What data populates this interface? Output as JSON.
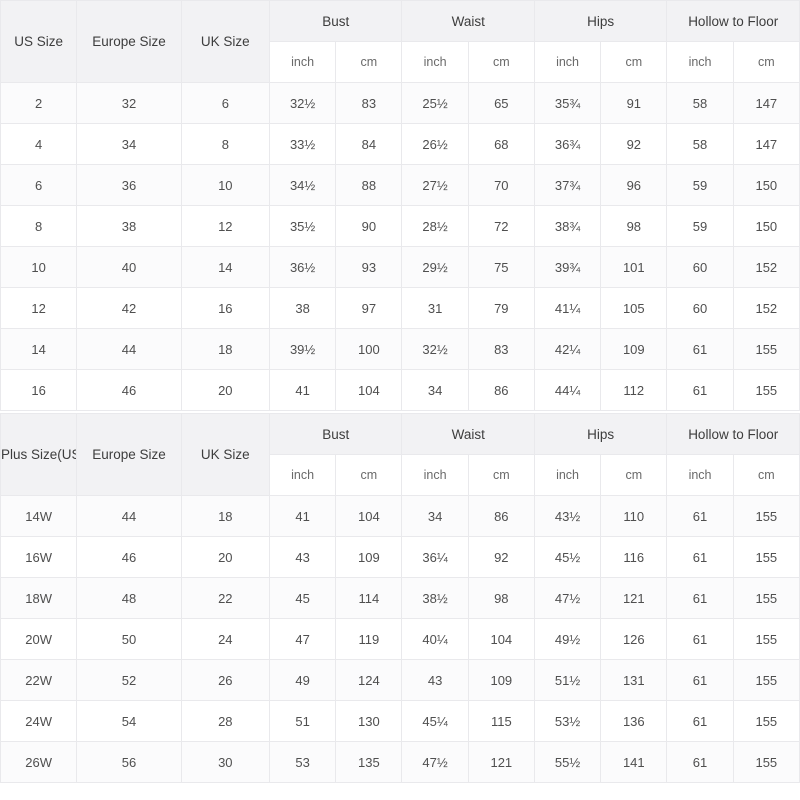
{
  "tables": [
    {
      "id": "standard-size-table",
      "headers": {
        "size": "US Size",
        "europe": "Europe Size",
        "uk": "UK Size",
        "bust": "Bust",
        "waist": "Waist",
        "hips": "Hips",
        "hollow": "Hollow to Floor"
      },
      "units": {
        "inch": "inch",
        "cm": "cm"
      },
      "rows": [
        {
          "size": "2",
          "europe": "32",
          "uk": "6",
          "bust_in": "32½",
          "bust_cm": "83",
          "waist_in": "25½",
          "waist_cm": "65",
          "hips_in": "35¾",
          "hips_cm": "91",
          "hollow_in": "58",
          "hollow_cm": "147"
        },
        {
          "size": "4",
          "europe": "34",
          "uk": "8",
          "bust_in": "33½",
          "bust_cm": "84",
          "waist_in": "26½",
          "waist_cm": "68",
          "hips_in": "36¾",
          "hips_cm": "92",
          "hollow_in": "58",
          "hollow_cm": "147"
        },
        {
          "size": "6",
          "europe": "36",
          "uk": "10",
          "bust_in": "34½",
          "bust_cm": "88",
          "waist_in": "27½",
          "waist_cm": "70",
          "hips_in": "37¾",
          "hips_cm": "96",
          "hollow_in": "59",
          "hollow_cm": "150"
        },
        {
          "size": "8",
          "europe": "38",
          "uk": "12",
          "bust_in": "35½",
          "bust_cm": "90",
          "waist_in": "28½",
          "waist_cm": "72",
          "hips_in": "38¾",
          "hips_cm": "98",
          "hollow_in": "59",
          "hollow_cm": "150"
        },
        {
          "size": "10",
          "europe": "40",
          "uk": "14",
          "bust_in": "36½",
          "bust_cm": "93",
          "waist_in": "29½",
          "waist_cm": "75",
          "hips_in": "39¾",
          "hips_cm": "101",
          "hollow_in": "60",
          "hollow_cm": "152"
        },
        {
          "size": "12",
          "europe": "42",
          "uk": "16",
          "bust_in": "38",
          "bust_cm": "97",
          "waist_in": "31",
          "waist_cm": "79",
          "hips_in": "41¼",
          "hips_cm": "105",
          "hollow_in": "60",
          "hollow_cm": "152"
        },
        {
          "size": "14",
          "europe": "44",
          "uk": "18",
          "bust_in": "39½",
          "bust_cm": "100",
          "waist_in": "32½",
          "waist_cm": "83",
          "hips_in": "42¼",
          "hips_cm": "109",
          "hollow_in": "61",
          "hollow_cm": "155"
        },
        {
          "size": "16",
          "europe": "46",
          "uk": "20",
          "bust_in": "41",
          "bust_cm": "104",
          "waist_in": "34",
          "waist_cm": "86",
          "hips_in": "44¼",
          "hips_cm": "112",
          "hollow_in": "61",
          "hollow_cm": "155"
        }
      ]
    },
    {
      "id": "plus-size-table",
      "headers": {
        "size": "Plus Size(US)",
        "europe": "Europe Size",
        "uk": "UK Size",
        "bust": "Bust",
        "waist": "Waist",
        "hips": "Hips",
        "hollow": "Hollow to Floor"
      },
      "units": {
        "inch": "inch",
        "cm": "cm"
      },
      "rows": [
        {
          "size": "14W",
          "europe": "44",
          "uk": "18",
          "bust_in": "41",
          "bust_cm": "104",
          "waist_in": "34",
          "waist_cm": "86",
          "hips_in": "43½",
          "hips_cm": "110",
          "hollow_in": "61",
          "hollow_cm": "155"
        },
        {
          "size": "16W",
          "europe": "46",
          "uk": "20",
          "bust_in": "43",
          "bust_cm": "109",
          "waist_in": "36¼",
          "waist_cm": "92",
          "hips_in": "45½",
          "hips_cm": "116",
          "hollow_in": "61",
          "hollow_cm": "155"
        },
        {
          "size": "18W",
          "europe": "48",
          "uk": "22",
          "bust_in": "45",
          "bust_cm": "114",
          "waist_in": "38½",
          "waist_cm": "98",
          "hips_in": "47½",
          "hips_cm": "121",
          "hollow_in": "61",
          "hollow_cm": "155"
        },
        {
          "size": "20W",
          "europe": "50",
          "uk": "24",
          "bust_in": "47",
          "bust_cm": "119",
          "waist_in": "40¼",
          "waist_cm": "104",
          "hips_in": "49½",
          "hips_cm": "126",
          "hollow_in": "61",
          "hollow_cm": "155"
        },
        {
          "size": "22W",
          "europe": "52",
          "uk": "26",
          "bust_in": "49",
          "bust_cm": "124",
          "waist_in": "43",
          "waist_cm": "109",
          "hips_in": "51½",
          "hips_cm": "131",
          "hollow_in": "61",
          "hollow_cm": "155"
        },
        {
          "size": "24W",
          "europe": "54",
          "uk": "28",
          "bust_in": "51",
          "bust_cm": "130",
          "waist_in": "45¼",
          "waist_cm": "115",
          "hips_in": "53½",
          "hips_cm": "136",
          "hollow_in": "61",
          "hollow_cm": "155"
        },
        {
          "size": "26W",
          "europe": "56",
          "uk": "30",
          "bust_in": "53",
          "bust_cm": "135",
          "waist_in": "47½",
          "waist_cm": "121",
          "hips_in": "55½",
          "hips_cm": "141",
          "hollow_in": "61",
          "hollow_cm": "155"
        }
      ]
    }
  ],
  "colors": {
    "header_bg": "#f2f2f4",
    "border": "#e9e9ec",
    "row_band": "#fbfbfc",
    "text": "#4f4f4f"
  }
}
